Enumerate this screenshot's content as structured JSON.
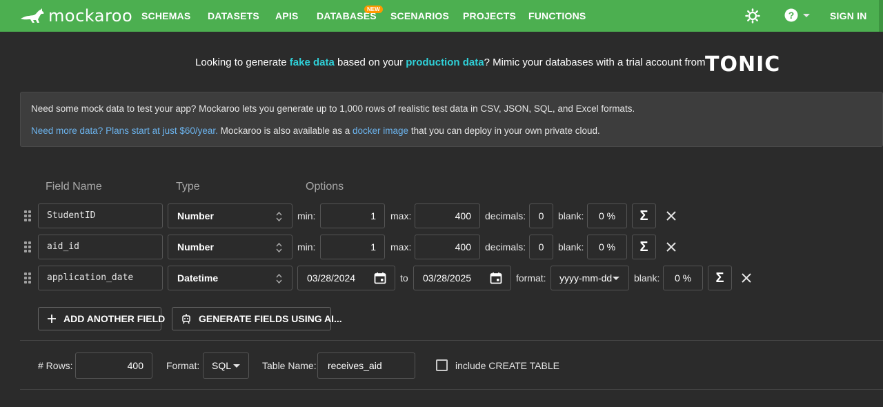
{
  "nav": {
    "logo_text": "mockaroo",
    "items": [
      "SCHEMAS",
      "DATASETS",
      "APIS",
      "DATABASES",
      "SCENARIOS",
      "PROJECTS",
      "FUNCTIONS"
    ],
    "new_badge": "NEW",
    "sign_in": "SIGN IN",
    "icons": [
      "theme-toggle-icon",
      "help-icon"
    ],
    "color": "#4caf50"
  },
  "promo": {
    "part1": "Looking to generate ",
    "hl1": "fake data",
    "part2": " based on your ",
    "hl2": "production data",
    "part3": "? Mimic your databases with a trial account from",
    "brand": "TONIC",
    "highlight_color": "#2fd0d8"
  },
  "info": {
    "line1": "Need some mock data to test your app? Mockaroo lets you generate up to 1,000 rows of realistic test data in CSV, JSON, SQL, and Excel formats.",
    "plans_link": "Need more data? Plans start at just $60/year.",
    "mid": " Mockaroo is also available as a ",
    "docker_link": "docker image",
    "end": " that you can deploy in your own private cloud."
  },
  "headers": {
    "field_name": "Field Name",
    "type": "Type",
    "options": "Options"
  },
  "fields": [
    {
      "name": "StudentID",
      "type": "Number",
      "min_label": "min:",
      "min": "1",
      "max_label": "max:",
      "max": "400",
      "decimals_label": "decimals:",
      "decimals": "0",
      "blank_label": "blank:",
      "blank": "0 %"
    },
    {
      "name": "aid_id",
      "type": "Number",
      "min_label": "min:",
      "min": "1",
      "max_label": "max:",
      "max": "400",
      "decimals_label": "decimals:",
      "decimals": "0",
      "blank_label": "blank:",
      "blank": "0 %"
    },
    {
      "name": "application_date",
      "type": "Datetime",
      "from": "03/28/2024",
      "to_label": "to",
      "to": "03/28/2025",
      "format_label": "format:",
      "format": "yyyy-mm-dd",
      "blank_label": "blank:",
      "blank": "0 %"
    }
  ],
  "buttons": {
    "add_field": "ADD ANOTHER FIELD",
    "generate_ai": "GENERATE FIELDS USING AI..."
  },
  "bottom": {
    "rows_label": "# Rows:",
    "rows": "400",
    "format_label": "Format:",
    "format": "SQL",
    "table_name_label": "Table Name:",
    "table_name": "receives_aid",
    "create_table_label": "include CREATE TABLE"
  }
}
